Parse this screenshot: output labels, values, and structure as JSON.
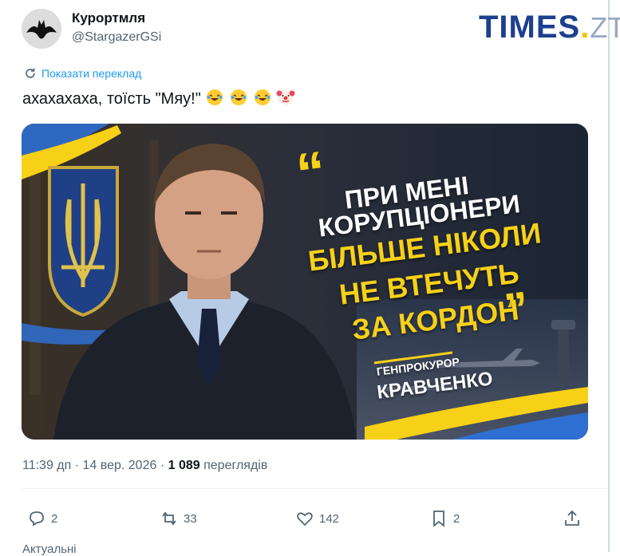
{
  "profile": {
    "display_name": "Курортмля",
    "handle": "@StargazerGSi",
    "avatar_icon": "batman-silhouette-icon"
  },
  "watermark": {
    "brand": "TIMES",
    "suffix": "ZT",
    "color": "#1d3f8f"
  },
  "tweet": {
    "translate_label": "Показати переклад",
    "text": "ахахахаха, тоїсть \"Мяу!\"",
    "emojis": [
      "face-with-tears-of-joy",
      "face-with-tears-of-joy",
      "face-with-tears-of-joy",
      "clown-face"
    ]
  },
  "image": {
    "quote_line1": "ПРИ МЕНІ",
    "quote_line2": "КОРУПЦІОНЕРИ",
    "quote_line3": "БІЛЬШЕ НІКОЛИ",
    "quote_line4": "НЕ ВТЕЧУТЬ",
    "quote_line5": "ЗА КОРДОН",
    "role": "ГЕНПРОКУРОР",
    "name": "КРАВЧЕНКО",
    "accent": "#f7d117",
    "flag_blue": "#2f6fd1"
  },
  "meta": {
    "time": "11:39 дп",
    "date": "14 вер. 2026",
    "views_count": "1 089",
    "views_label": "переглядів"
  },
  "actions": {
    "replies": "2",
    "reposts": "33",
    "likes": "142",
    "bookmarks": "2"
  },
  "bottom_hint": "Актуальні"
}
